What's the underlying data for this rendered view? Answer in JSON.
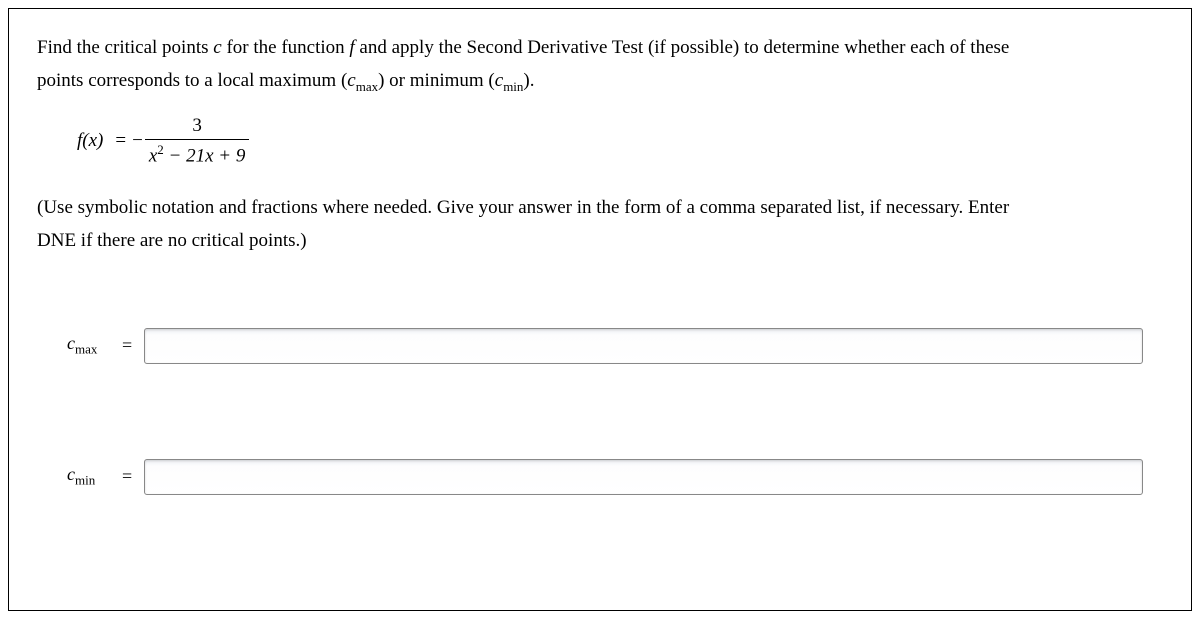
{
  "question": {
    "line1_part1": "Find the critical points ",
    "line1_c": "c",
    "line1_part2": " for the function ",
    "line1_f": "f",
    "line1_part3": " and apply the Second Derivative Test (if possible) to determine whether each of these",
    "line2_part1": "points corresponds to a local maximum (",
    "line2_cmax_c": "c",
    "line2_cmax_sub": "max",
    "line2_part2": ") or minimum (",
    "line2_cmin_c": "c",
    "line2_cmin_sub": "min",
    "line2_part3": ")."
  },
  "formula": {
    "lhs": "f(x)",
    "eq": "=",
    "neg": " −",
    "numerator": "3",
    "den_x": "x",
    "den_sup": "2",
    "den_rest": " − 21x + 9"
  },
  "instruction": {
    "line1": "(Use symbolic notation and fractions where needed. Give your answer in the form of a comma separated list, if necessary. Enter",
    "line2": "DNE if there are no critical points.)"
  },
  "answers": {
    "cmax_c": "c",
    "cmax_sub": "max",
    "cmin_c": "c",
    "cmin_sub": "min",
    "eq": "=",
    "cmax_value": "",
    "cmin_value": ""
  }
}
